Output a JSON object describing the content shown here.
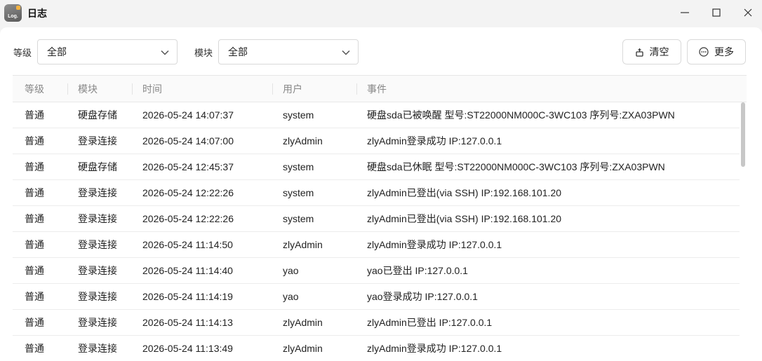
{
  "window": {
    "title": "日志",
    "icon_text": "Log.",
    "controls": [
      "minimize-icon",
      "maximize-icon",
      "close-icon"
    ]
  },
  "filters": {
    "level_label": "等级",
    "level_value": "全部",
    "module_label": "模块",
    "module_value": "全部"
  },
  "actions": {
    "clear_label": "清空",
    "more_label": "更多"
  },
  "table": {
    "columns": [
      "等级",
      "模块",
      "时间",
      "用户",
      "事件"
    ],
    "rows": [
      {
        "level": "普通",
        "module": "硬盘存储",
        "time": "2026-05-24 14:07:37",
        "user": "system",
        "event": "硬盘sda已被唤醒 型号:ST22000NM000C-3WC103 序列号:ZXA03PWN"
      },
      {
        "level": "普通",
        "module": "登录连接",
        "time": "2026-05-24 14:07:00",
        "user": "zlyAdmin",
        "event": "zlyAdmin登录成功 IP:127.0.0.1"
      },
      {
        "level": "普通",
        "module": "硬盘存储",
        "time": "2026-05-24 12:45:37",
        "user": "system",
        "event": "硬盘sda已休眠 型号:ST22000NM000C-3WC103 序列号:ZXA03PWN"
      },
      {
        "level": "普通",
        "module": "登录连接",
        "time": "2026-05-24 12:22:26",
        "user": "system",
        "event": "zlyAdmin已登出(via SSH) IP:192.168.101.20"
      },
      {
        "level": "普通",
        "module": "登录连接",
        "time": "2026-05-24 12:22:26",
        "user": "system",
        "event": "zlyAdmin已登出(via SSH) IP:192.168.101.20"
      },
      {
        "level": "普通",
        "module": "登录连接",
        "time": "2026-05-24 11:14:50",
        "user": "zlyAdmin",
        "event": "zlyAdmin登录成功 IP:127.0.0.1"
      },
      {
        "level": "普通",
        "module": "登录连接",
        "time": "2026-05-24 11:14:40",
        "user": "yao",
        "event": "yao已登出 IP:127.0.0.1"
      },
      {
        "level": "普通",
        "module": "登录连接",
        "time": "2026-05-24 11:14:19",
        "user": "yao",
        "event": "yao登录成功 IP:127.0.0.1"
      },
      {
        "level": "普通",
        "module": "登录连接",
        "time": "2026-05-24 11:14:13",
        "user": "zlyAdmin",
        "event": "zlyAdmin已登出 IP:127.0.0.1"
      },
      {
        "level": "普通",
        "module": "登录连接",
        "time": "2026-05-24 11:13:49",
        "user": "zlyAdmin",
        "event": "zlyAdmin登录成功 IP:127.0.0.1"
      }
    ]
  }
}
